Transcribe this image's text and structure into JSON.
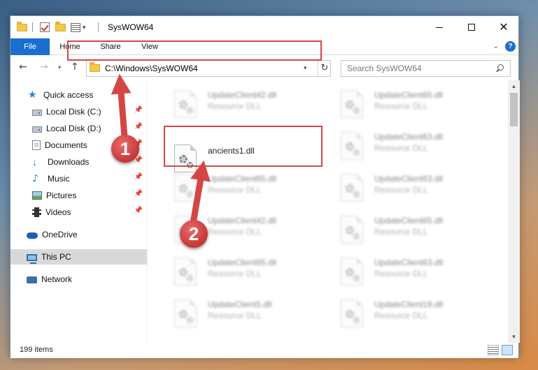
{
  "window": {
    "title": "SysWOW64",
    "minimize_glyph": "",
    "close_glyph": "✕"
  },
  "ribbon": {
    "tabs": [
      "File",
      "Home",
      "Share",
      "View"
    ],
    "expand_glyph": "⌄",
    "help_glyph": "?",
    "accent": "#1a6fce"
  },
  "nav": {
    "back_glyph": "←",
    "forward_glyph": "→",
    "recent_glyph": "▾",
    "up_glyph": "↑",
    "address": "C:\\Windows\\SysWOW64",
    "address_dropdown_glyph": "▾",
    "refresh_glyph": "↻",
    "search_placeholder": "Search SysWOW64"
  },
  "sidebar": {
    "items": [
      {
        "label": "Quick access",
        "icon": "star-icon"
      },
      {
        "label": "Local Disk (C:)",
        "icon": "drive-icon",
        "pinned": true
      },
      {
        "label": "Local Disk (D:)",
        "icon": "drive-icon",
        "pinned": true
      },
      {
        "label": "Documents",
        "icon": "documents-icon",
        "pinned": true
      },
      {
        "label": "Downloads",
        "icon": "downloads-icon",
        "pinned": true
      },
      {
        "label": "Music",
        "icon": "music-icon",
        "pinned": true
      },
      {
        "label": "Pictures",
        "icon": "pictures-icon",
        "pinned": true
      },
      {
        "label": "Videos",
        "icon": "videos-icon",
        "pinned": true
      },
      {
        "label": "OneDrive",
        "icon": "onedrive-icon"
      },
      {
        "label": "This PC",
        "icon": "computer-icon",
        "selected": true
      },
      {
        "label": "Network",
        "icon": "network-icon"
      }
    ],
    "pin_glyph": "📌"
  },
  "files": [
    {
      "name": "UpdateClient42.dll",
      "type": "Resource DLL",
      "blurred": true
    },
    {
      "name": "UpdateClient65.dll",
      "type": "Resource DLL",
      "blurred": true
    },
    {
      "name": "ancients1.dll",
      "type": "",
      "blurred": false
    },
    {
      "name": "UpdateClient63.dll",
      "type": "Resource DLL",
      "blurred": true
    },
    {
      "name": "UpdateClient65.dll",
      "type": "Resource DLL",
      "blurred": true
    },
    {
      "name": "UpdateClient63.dll",
      "type": "Resource DLL",
      "blurred": true
    },
    {
      "name": "UpdateClient42.dll",
      "type": "Resource DLL",
      "blurred": true
    },
    {
      "name": "UpdateClient65.dll",
      "type": "Resource DLL",
      "blurred": true
    },
    {
      "name": "UpdateClient65.dll",
      "type": "Resource DLL",
      "blurred": true
    },
    {
      "name": "UpdateClient63.dll",
      "type": "Resource DLL",
      "blurred": true
    },
    {
      "name": "UpdateClient5.dll",
      "type": "Resource DLL",
      "blurred": true
    },
    {
      "name": "UpdateClient19.dll",
      "type": "Resource DLL",
      "blurred": true
    }
  ],
  "scrollbar": {
    "up_glyph": "▲",
    "down_glyph": "▼"
  },
  "status": {
    "item_count": "199 items"
  },
  "annotations": {
    "step1": "1",
    "step2": "2",
    "color": "#d64545"
  }
}
